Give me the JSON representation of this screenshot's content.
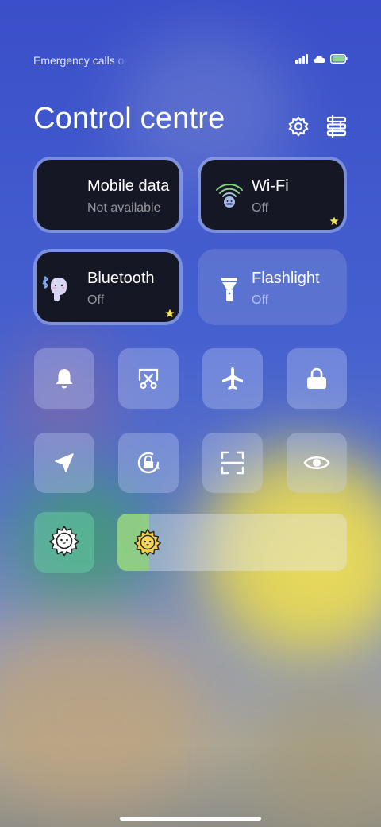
{
  "status_bar": {
    "carrier_text": "Emergency calls only",
    "signal_icon": "signal-bars-icon",
    "cloud_icon": "cloud-icon",
    "battery_icon": "battery-icon",
    "battery_color": "#8fd58a"
  },
  "header": {
    "title": "Control centre",
    "settings_icon": "gear-icon",
    "edit_icon": "edit-list-icon"
  },
  "tiles": {
    "mobile_data": {
      "name": "Mobile data",
      "status": "Not available",
      "icon": "mobile-data-icon"
    },
    "wifi": {
      "name": "Wi-Fi",
      "status": "Off",
      "icon": "wifi-icon",
      "favorite": true
    },
    "bluetooth": {
      "name": "Bluetooth",
      "status": "Off",
      "icon": "bluetooth-icon",
      "favorite": true
    },
    "flashlight": {
      "name": "Flashlight",
      "status": "Off",
      "icon": "flashlight-icon"
    }
  },
  "toggles_row1": [
    "bell-icon",
    "screenshot-cut-icon",
    "airplane-icon",
    "lock-icon"
  ],
  "toggles_row2": [
    "location-arrow-icon",
    "rotation-lock-icon",
    "scan-icon",
    "eye-icon"
  ],
  "brightness": {
    "auto_icon": "auto-brightness-icon",
    "slider_icon": "brightness-sun-icon",
    "level_fraction": 0.14,
    "accent": "#8fcf80"
  },
  "colors": {
    "star": "#f5e35a",
    "tile_dark": "#151724"
  }
}
